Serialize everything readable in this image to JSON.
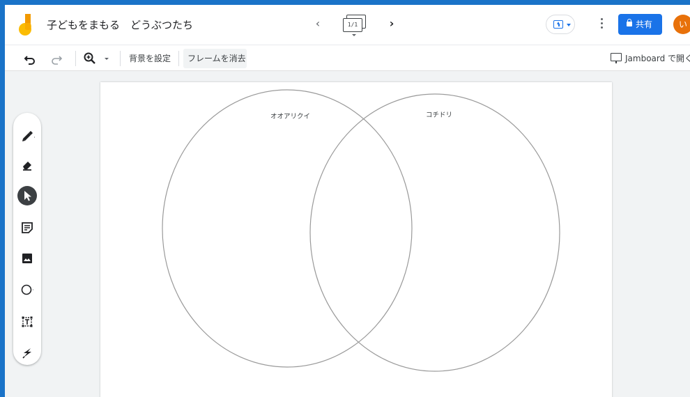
{
  "header": {
    "title": "子どもをまもる　どうぶつたち",
    "frame_indicator": "1/1",
    "share_label": "共有",
    "avatar_initial": "い"
  },
  "toolbar": {
    "set_background": "背景を設定",
    "clear_frame": "フレームを消去",
    "open_in_jamboard": "Jamboard で開く"
  },
  "tools": [
    "pen",
    "eraser",
    "select",
    "sticky-note",
    "image",
    "shape",
    "text-box",
    "laser"
  ],
  "canvas": {
    "left_circle_label": "オオアリクイ",
    "right_circle_label": "コチドリ"
  },
  "colors": {
    "brand_blue": "#1a73e8",
    "avatar_orange": "#e8710a",
    "logo_yellow": "#fbbc04",
    "logo_orange": "#f29900"
  }
}
